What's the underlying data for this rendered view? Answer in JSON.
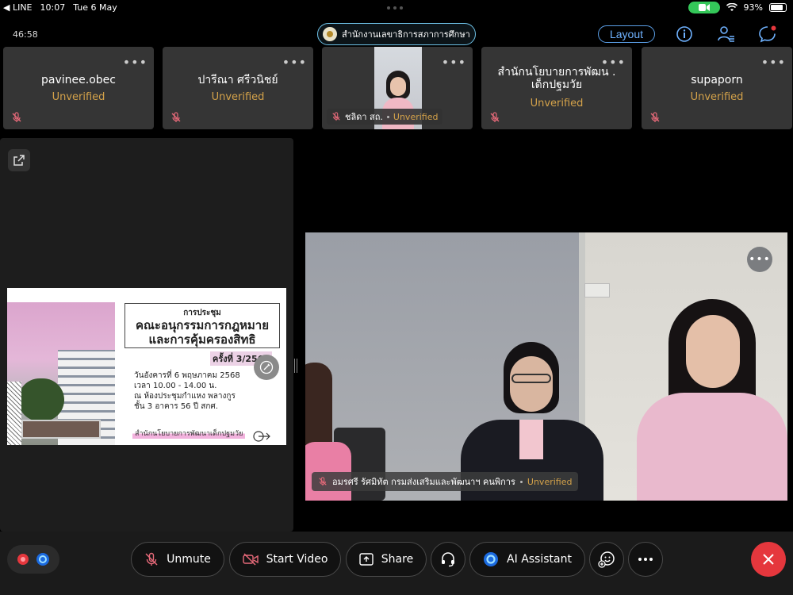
{
  "status_bar": {
    "back_app": "◀ LINE",
    "time": "10:07",
    "date": "Tue 6 May",
    "battery": "93%"
  },
  "meeting": {
    "timer": "46:58",
    "title": "สำนักงานเลขาธิการสภาการศึกษา",
    "layout_label": "Layout"
  },
  "participants": [
    {
      "name": "pavinee.obec",
      "status": "Unverified"
    },
    {
      "name": "ปารีณา ศรีวนิชย์",
      "status": "Unverified"
    },
    {
      "name": "ชลิดา สถ.",
      "status": "Unverified"
    },
    {
      "name": "สำนักนโยบายการพัฒน . เด็กปฐมวัย",
      "status": "Unverified"
    },
    {
      "name": "supaporn",
      "status": "Unverified"
    }
  ],
  "slide": {
    "small_title": "การประชุม",
    "big_title_1": "คณะอนุกรรมการกฎหมาย",
    "big_title_2": "และการคุ้มครองสิทธิ",
    "session": "ครั้งที่ 3/2568",
    "details": "วันอังคารที่ 6 พฤษภาคม 2568\nเวลา 10.00 - 14.00 น.\nณ ห้องประชุมกำแหง พลางกูร\nชั้น 3 อาคาร 56 ปี สกศ.",
    "footer": "สำนักนโยบายการพัฒนาเด็กปฐมวัย"
  },
  "active_speaker": {
    "name": "อมรศรี รัศมิทัต กรมส่งเสริมและพัฒนาฯ คนพิการ",
    "status": "Unverified"
  },
  "toolbar": {
    "unmute": "Unmute",
    "start_video": "Start Video",
    "share": "Share",
    "ai_assistant": "AI Assistant"
  },
  "colors": {
    "accent_blue": "#5a9ee6",
    "unverified": "#d4a24a",
    "leave_red": "#e5373d",
    "battery_cam_green": "#34c759"
  }
}
